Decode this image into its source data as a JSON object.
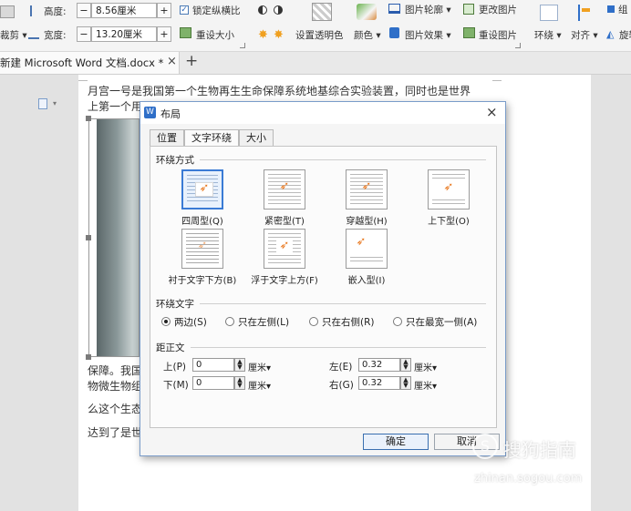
{
  "ribbon": {
    "height_label": "高度:",
    "height_value": "8.56厘米",
    "width_label": "宽度:",
    "width_value": "13.20厘米",
    "crop_label": "裁剪",
    "lock_ratio": "锁定纵横比",
    "reset_size": "重设大小",
    "set_transparent": "设置透明色",
    "color": "颜色",
    "picture_outline": "图片轮廓",
    "picture_effect": "图片效果",
    "change_picture": "更改图片",
    "reset_picture": "重设图片",
    "wrap": "环绕",
    "align": "对齐",
    "rotate": "旋转",
    "combine": "组"
  },
  "tabbar": {
    "doc_tab": "新建 Microsoft Word 文档.docx *",
    "close": "×",
    "add": "+"
  },
  "document": {
    "line1": "月宫一号是我国第一个生物再生生命保障系统地基综合实验装置，同时也是世界",
    "line2": "上第一个用",
    "line3": "保障。我国",
    "line4": "物微生物组",
    "line5": "么这个生态",
    "line6": "达到了是世"
  },
  "dialog": {
    "title": "布局",
    "close": "×",
    "tabs": [
      "位置",
      "文字环绕",
      "大小"
    ],
    "active_tab": "文字环绕",
    "wrap_style_title": "环绕方式",
    "wrap_styles": [
      {
        "label": "四周型(Q)",
        "selected": true
      },
      {
        "label": "紧密型(T)",
        "selected": false
      },
      {
        "label": "穿越型(H)",
        "selected": false
      },
      {
        "label": "上下型(O)",
        "selected": false
      },
      {
        "label": "衬于文字下方(B)",
        "selected": false
      },
      {
        "label": "浮于文字上方(F)",
        "selected": false
      },
      {
        "label": "嵌入型(I)",
        "selected": false
      }
    ],
    "wrap_text_title": "环绕文字",
    "wrap_text_options": [
      {
        "label": "两边(S)",
        "checked": true
      },
      {
        "label": "只在左侧(L)",
        "checked": false
      },
      {
        "label": "只在右侧(R)",
        "checked": false
      },
      {
        "label": "只在最宽一侧(A)",
        "checked": false
      }
    ],
    "distance_title": "距正文",
    "top_label": "上(P)",
    "top_value": "0",
    "bottom_label": "下(M)",
    "bottom_value": "0",
    "left_label": "左(E)",
    "left_value": "0.32",
    "right_label": "右(G)",
    "right_value": "0.32",
    "unit": "厘米",
    "ok": "确定",
    "cancel": "取消"
  },
  "watermark": {
    "brand": "搜狗指南",
    "url": "zhinan.sogou.com"
  },
  "colors": {
    "accent": "#3a7bd5",
    "dialog_border": "#7a9cc9",
    "icon_orange": "#e8761c"
  }
}
